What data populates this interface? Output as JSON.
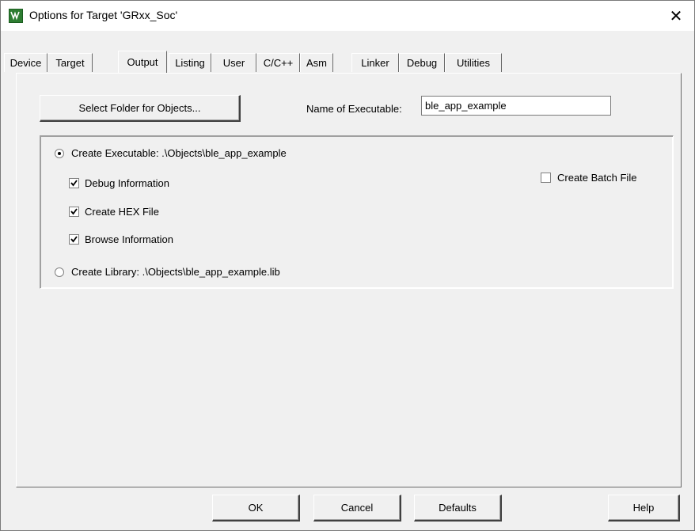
{
  "window": {
    "title": "Options for Target 'GRxx_Soc'",
    "close_glyph": "✕",
    "app_icon": "keil-uvision-icon"
  },
  "tabs": [
    {
      "label": "Device",
      "active": false
    },
    {
      "label": "Target",
      "active": false
    },
    {
      "label": "Output",
      "active": true
    },
    {
      "label": "Listing",
      "active": false
    },
    {
      "label": "User",
      "active": false
    },
    {
      "label": "C/C++",
      "active": false
    },
    {
      "label": "Asm",
      "active": false
    },
    {
      "label": "Linker",
      "active": false
    },
    {
      "label": "Debug",
      "active": false
    },
    {
      "label": "Utilities",
      "active": false
    }
  ],
  "output": {
    "select_folder_label": "Select Folder for Objects...",
    "name_of_executable_label": "Name of Executable:",
    "name_of_executable_value": "ble_app_example",
    "create_executable_label": "Create Executable:  .\\Objects\\ble_app_example",
    "create_executable_selected": true,
    "debug_information_label": "Debug Information",
    "debug_information_checked": true,
    "create_hex_label": "Create HEX File",
    "create_hex_checked": true,
    "browse_information_label": "Browse Information",
    "browse_information_checked": true,
    "create_batch_label": "Create Batch File",
    "create_batch_checked": false,
    "create_library_label": "Create Library:  .\\Objects\\ble_app_example.lib",
    "create_library_selected": false
  },
  "buttons": {
    "ok": "OK",
    "cancel": "Cancel",
    "defaults": "Defaults",
    "help": "Help"
  }
}
